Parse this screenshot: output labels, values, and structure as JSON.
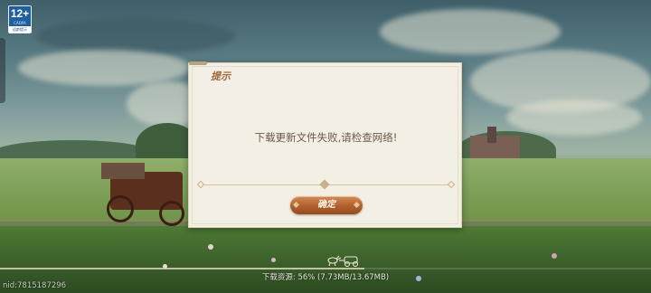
{
  "age_rating": {
    "number": "12+",
    "org": "CADPA",
    "caption": "适龄提示",
    "color": "#1f5f9f"
  },
  "dialog": {
    "title": "提示",
    "message": "下载更新文件失败,请检查网络!",
    "confirm_label": "确定",
    "accent_color": "#b05f2c"
  },
  "download": {
    "status_text": "下载资源: 56% (7.73MB/13.67MB)",
    "progress": 0.56
  },
  "user": {
    "id_text": "nid:7815187296"
  },
  "icons": {
    "progress_marker": "horse-carriage-icon"
  }
}
